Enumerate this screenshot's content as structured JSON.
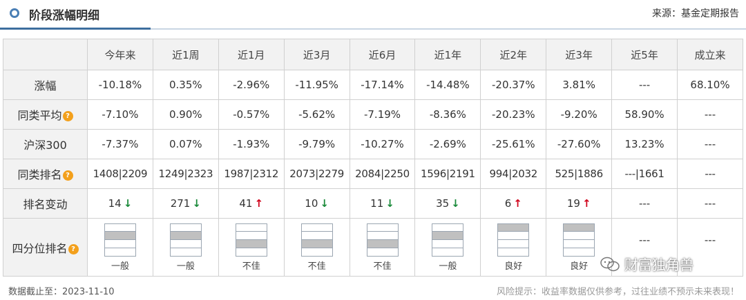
{
  "header": {
    "title": "阶段涨幅明细",
    "source": "来源：基金定期报告"
  },
  "table": {
    "columns": [
      "今年来",
      "近1周",
      "近1月",
      "近3月",
      "近6月",
      "近1年",
      "近2年",
      "近3年",
      "近5年",
      "成立来"
    ],
    "rows": {
      "gain": {
        "label": "涨幅",
        "values": [
          "-10.18%",
          "0.35%",
          "-2.96%",
          "-11.95%",
          "-17.14%",
          "-14.48%",
          "-20.37%",
          "3.81%",
          "---",
          "68.10%"
        ],
        "signs": [
          "neg",
          "pos",
          "neg",
          "neg",
          "neg",
          "neg",
          "neg",
          "pos",
          "dash",
          "pos"
        ]
      },
      "peer_avg": {
        "label": "同类平均",
        "values": [
          "-7.10%",
          "0.90%",
          "-0.57%",
          "-5.62%",
          "-7.19%",
          "-8.36%",
          "-20.23%",
          "-9.20%",
          "58.90%",
          "---"
        ],
        "signs": [
          "neg",
          "pos",
          "neg",
          "neg",
          "neg",
          "neg",
          "neg",
          "neg",
          "pos",
          "dash"
        ]
      },
      "hs300": {
        "label": "沪深300",
        "values": [
          "-7.37%",
          "0.07%",
          "-1.93%",
          "-9.79%",
          "-10.27%",
          "-2.69%",
          "-25.61%",
          "-27.60%",
          "13.23%",
          "---"
        ],
        "signs": [
          "neg",
          "pos",
          "neg",
          "neg",
          "neg",
          "neg",
          "neg",
          "neg",
          "pos",
          "dash"
        ]
      },
      "peer_rank": {
        "label": "同类排名",
        "values": [
          "1408|2209",
          "1249|2323",
          "1987|2312",
          "2073|2279",
          "2084|2250",
          "1596|2191",
          "994|2032",
          "525|1886",
          "---|1661",
          "---"
        ]
      },
      "rank_change": {
        "label": "排名变动",
        "values": [
          "14",
          "271",
          "41",
          "10",
          "11",
          "35",
          "6",
          "19",
          "---",
          "---"
        ],
        "arrows": [
          "down",
          "down",
          "up",
          "down",
          "down",
          "down",
          "up",
          "up",
          "",
          ""
        ]
      },
      "quartile": {
        "label": "四分位排名",
        "levels": [
          2,
          2,
          3,
          3,
          3,
          2,
          1,
          1,
          0,
          0
        ],
        "labels": [
          "一般",
          "一般",
          "不佳",
          "不佳",
          "不佳",
          "一般",
          "良好",
          "良好",
          "---",
          "---"
        ]
      }
    },
    "help_icon": "question-circle-icon"
  },
  "footer": {
    "date_label": "数据截止至：2023-11-10",
    "risk": "风险提示：收益率数据仅供参考，过往业绩不预示未来表现！"
  },
  "watermark": {
    "text": "财富独角兽",
    "icon": "wechat-icon"
  },
  "colors": {
    "negative": "#1a8a3a",
    "positive": "#d0021b",
    "accent": "#3d6e9e",
    "help_icon": "#f3a01c"
  }
}
